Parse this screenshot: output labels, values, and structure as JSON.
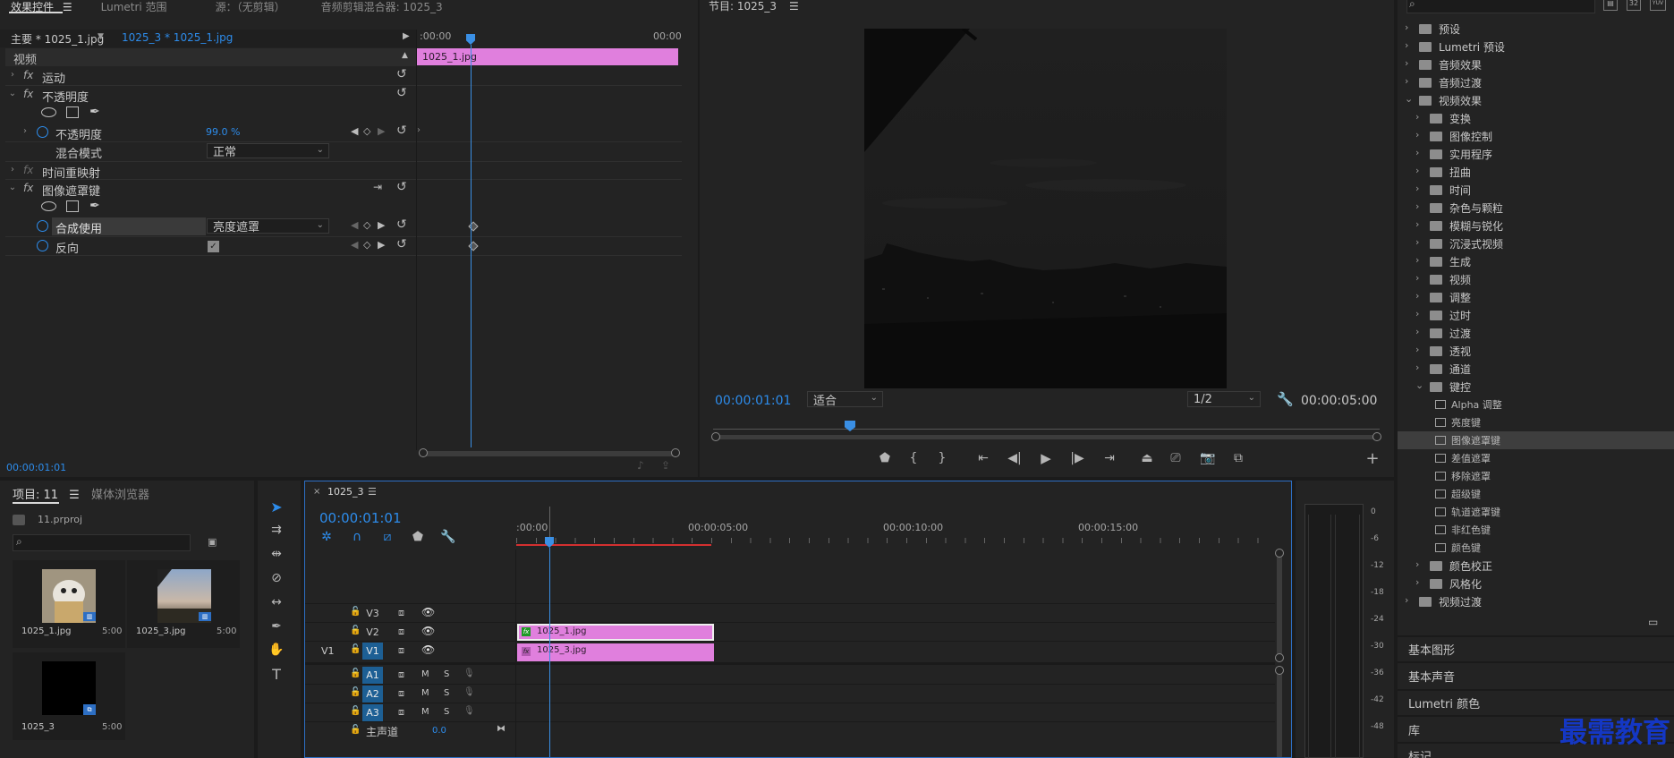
{
  "effect_controls": {
    "tabs": [
      "效果控件",
      "Lumetri 范围",
      "源：（无剪辑）",
      "音频剪辑混合器: 1025_3"
    ],
    "master_label": "主要 * 1025_1.jpg",
    "sequence_label": "1025_3 * 1025_1.jpg",
    "mini_ruler_start": ":00:00",
    "mini_ruler_end": "00:00",
    "clip_name": "1025_1.jpg",
    "section": "视频",
    "fx_motion": "运动",
    "fx_opacity": "不透明度",
    "opacity_label": "不透明度",
    "opacity_value": "99.0 %",
    "blend_label": "混合模式",
    "blend_value": "正常",
    "time_remap": "时间重映射",
    "fx_track_matte": "图像遮罩键",
    "composite_label": "合成使用",
    "composite_value": "亮度遮罩",
    "reverse_label": "反向",
    "timecode": "00:00:01:01"
  },
  "program": {
    "title": "节目: 1025_3",
    "timecode": "00:00:01:01",
    "fit_value": "适合",
    "resolution_value": "1/2",
    "duration": "00:00:05:00"
  },
  "effects_panel": {
    "items": [
      {
        "label": "预设",
        "level": 0,
        "type": "star-bin"
      },
      {
        "label": "Lumetri 预设",
        "level": 0,
        "type": "star-bin"
      },
      {
        "label": "音频效果",
        "level": 0,
        "type": "folder"
      },
      {
        "label": "音频过渡",
        "level": 0,
        "type": "folder"
      },
      {
        "label": "视频效果",
        "level": 0,
        "type": "folder",
        "open": true
      },
      {
        "label": "变换",
        "level": 1,
        "type": "folder"
      },
      {
        "label": "图像控制",
        "level": 1,
        "type": "folder"
      },
      {
        "label": "实用程序",
        "level": 1,
        "type": "folder"
      },
      {
        "label": "扭曲",
        "level": 1,
        "type": "folder"
      },
      {
        "label": "时间",
        "level": 1,
        "type": "folder"
      },
      {
        "label": "杂色与颗粒",
        "level": 1,
        "type": "folder"
      },
      {
        "label": "模糊与锐化",
        "level": 1,
        "type": "folder"
      },
      {
        "label": "沉浸式视频",
        "level": 1,
        "type": "folder"
      },
      {
        "label": "生成",
        "level": 1,
        "type": "folder"
      },
      {
        "label": "视频",
        "level": 1,
        "type": "folder"
      },
      {
        "label": "调整",
        "level": 1,
        "type": "folder"
      },
      {
        "label": "过时",
        "level": 1,
        "type": "folder"
      },
      {
        "label": "过渡",
        "level": 1,
        "type": "folder"
      },
      {
        "label": "透视",
        "level": 1,
        "type": "folder"
      },
      {
        "label": "通道",
        "level": 1,
        "type": "folder"
      },
      {
        "label": "键控",
        "level": 1,
        "type": "folder",
        "open": true
      },
      {
        "label": "Alpha 调整",
        "level": 2,
        "type": "fx"
      },
      {
        "label": "亮度键",
        "level": 2,
        "type": "fx"
      },
      {
        "label": "图像遮罩键",
        "level": 2,
        "type": "fx",
        "selected": true
      },
      {
        "label": "差值遮罩",
        "level": 2,
        "type": "fx"
      },
      {
        "label": "移除遮罩",
        "level": 2,
        "type": "fx"
      },
      {
        "label": "超级键",
        "level": 2,
        "type": "fx"
      },
      {
        "label": "轨道遮罩键",
        "level": 2,
        "type": "fx"
      },
      {
        "label": "非红色键",
        "level": 2,
        "type": "fx"
      },
      {
        "label": "颜色键",
        "level": 2,
        "type": "fx"
      },
      {
        "label": "颜色校正",
        "level": 1,
        "type": "folder"
      },
      {
        "label": "风格化",
        "level": 1,
        "type": "folder"
      },
      {
        "label": "视频过渡",
        "level": 0,
        "type": "folder"
      }
    ],
    "badges": [
      "32",
      "YUV"
    ],
    "panels": [
      "基本图形",
      "基本声音",
      "Lumetri 颜色",
      "库",
      "标记"
    ]
  },
  "project": {
    "tabs": [
      "项目: 11",
      "媒体浏览器"
    ],
    "file": "11.prproj",
    "items": [
      {
        "name": "1025_1.jpg",
        "duration": "5:00"
      },
      {
        "name": "1025_3.jpg",
        "duration": "5:00"
      },
      {
        "name": "1025_3",
        "duration": "5:00"
      }
    ]
  },
  "timeline": {
    "tab": "1025_3",
    "timecode": "00:00:01:01",
    "ruler": [
      ":00:00",
      "00:00:05:00",
      "00:00:10:00",
      "00:00:15:00"
    ],
    "video_tracks": [
      {
        "name": "V3",
        "src": ""
      },
      {
        "name": "V2",
        "src": ""
      },
      {
        "name": "V1",
        "src": "V1"
      }
    ],
    "audio_tracks": [
      {
        "name": "A1"
      },
      {
        "name": "A2"
      },
      {
        "name": "A3"
      }
    ],
    "track_m": "M",
    "track_s": "S",
    "master_label": "主声道",
    "master_value": "0.0",
    "clip_v2": "1025_1.jpg",
    "clip_v1": "1025_3.jpg"
  },
  "meter_scale": [
    "0",
    "-6",
    "-12",
    "-18",
    "-24",
    "-30",
    "-36",
    "-42",
    "-48"
  ],
  "watermark": "最需教育",
  "colors": {
    "accent": "#2d8ceb",
    "clip_pink": "#e07fdd",
    "selected_track": "#1d5f94",
    "playhead": "#3a8fe4"
  }
}
